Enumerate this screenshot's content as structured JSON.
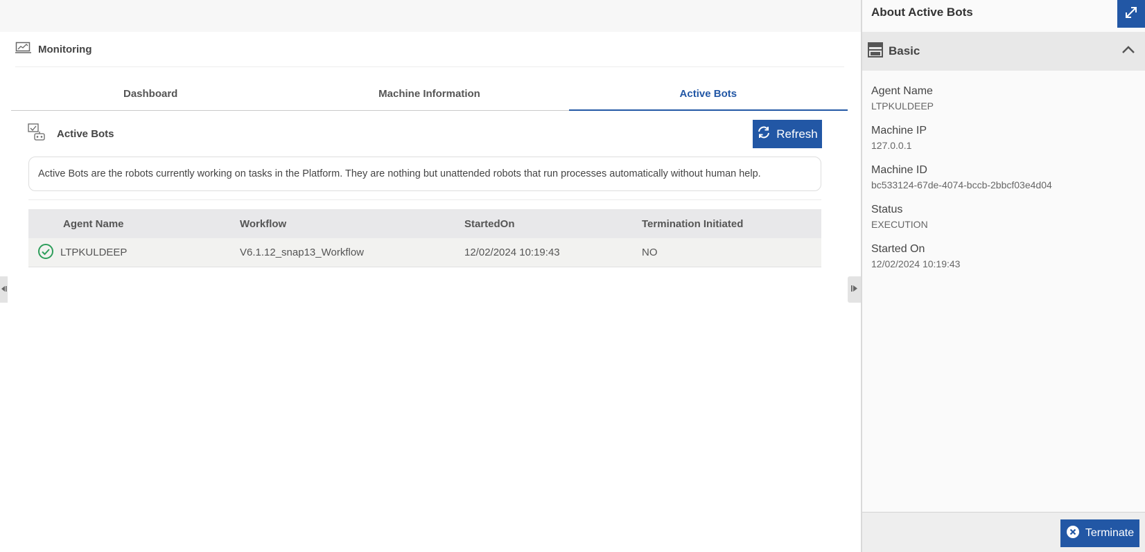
{
  "module": {
    "title": "Monitoring",
    "icon": "monitor-chart-icon"
  },
  "tabs": [
    {
      "label": "Dashboard",
      "active": false
    },
    {
      "label": "Machine Information",
      "active": false
    },
    {
      "label": "Active Bots",
      "active": true
    }
  ],
  "section": {
    "title": "Active Bots",
    "icon": "active-bots-icon",
    "refresh_label": "Refresh",
    "description": "Active Bots are the robots currently working on tasks in the Platform. They are nothing but unattended robots that run processes automatically without human help."
  },
  "table": {
    "columns": [
      "Agent Name",
      "Workflow",
      "StartedOn",
      "Termination Initiated"
    ],
    "rows": [
      {
        "status_icon": "check-circle-icon",
        "agent_name": "LTPKULDEEP",
        "workflow": "V6.1.12_snap13_Workflow",
        "started_on": "12/02/2024 10:19:43",
        "termination_initiated": "NO"
      }
    ]
  },
  "panel": {
    "title": "About Active Bots",
    "expand_icon": "expand-icon",
    "section_label": "Basic",
    "fields": [
      {
        "label": "Agent Name",
        "value": "LTPKULDEEP"
      },
      {
        "label": "Machine IP",
        "value": "127.0.0.1"
      },
      {
        "label": "Machine ID",
        "value": "bc533124-67de-4074-bccb-2bbcf03e4d04"
      },
      {
        "label": "Status",
        "value": "EXECUTION"
      },
      {
        "label": "Started On",
        "value": "12/02/2024 10:19:43"
      }
    ],
    "terminate_label": "Terminate"
  },
  "colors": {
    "accent": "#2257a5",
    "success": "#2e9e5b"
  }
}
